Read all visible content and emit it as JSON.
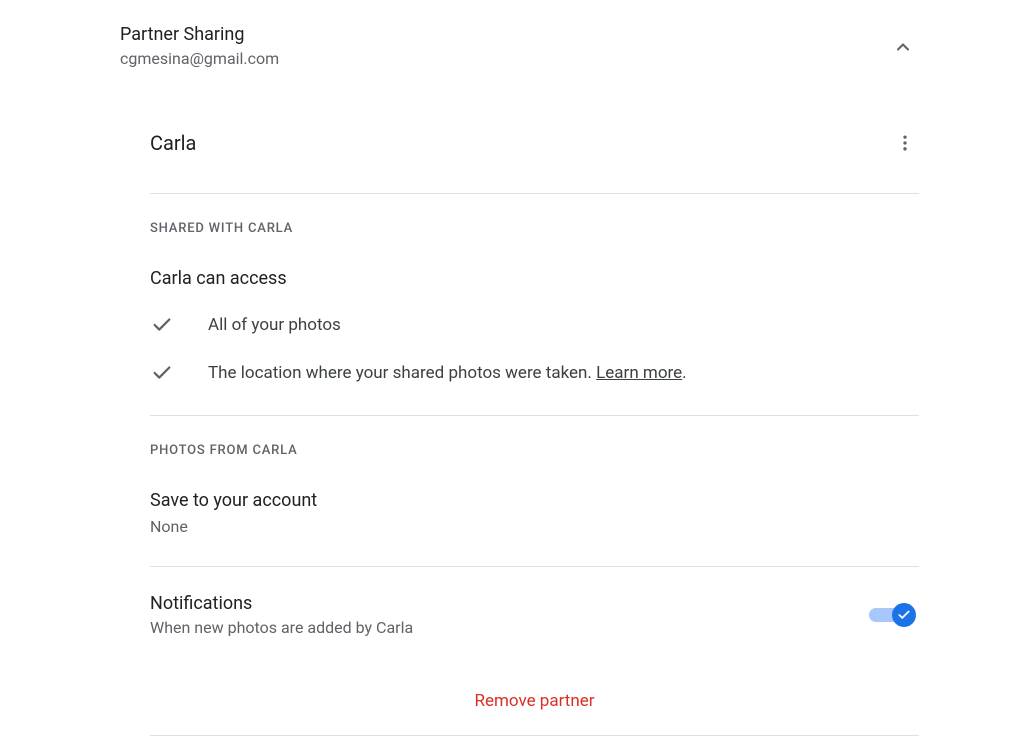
{
  "header": {
    "title": "Partner Sharing",
    "email": "cgmesina@gmail.com"
  },
  "partner": {
    "name": "Carla"
  },
  "sections": {
    "shared_with_heading": "SHARED WITH CARLA",
    "access_title": "Carla can access",
    "access_items": [
      "All of your photos",
      "The location where your shared photos were taken. "
    ],
    "learn_more": "Learn more",
    "photos_from_heading": "PHOTOS FROM CARLA",
    "save_title": "Save to your account",
    "save_value": "None",
    "notifications_title": "Notifications",
    "notifications_desc": "When new photos are added by Carla"
  },
  "actions": {
    "remove_partner": "Remove partner"
  }
}
